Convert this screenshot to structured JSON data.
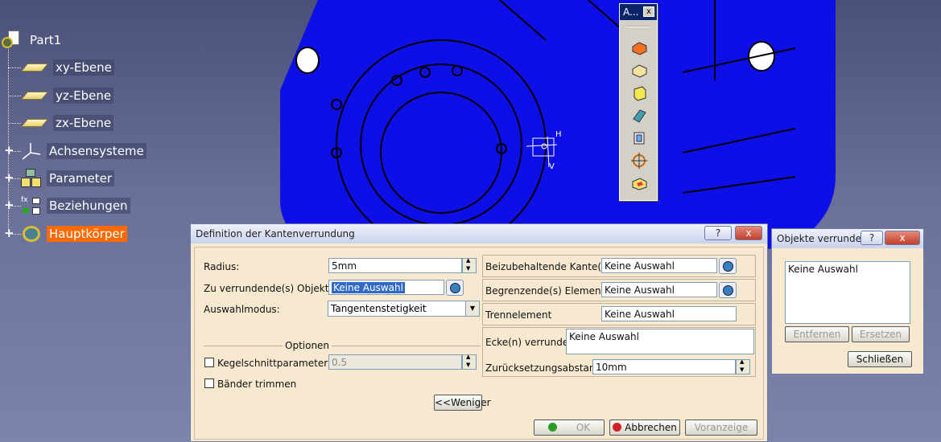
{
  "tree": {
    "root": "Part1",
    "items": [
      "xy-Ebene",
      "yz-Ebene",
      "zx-Ebene",
      "Achsensysteme",
      "Parameter",
      "Beziehungen",
      "Hauptkörper"
    ]
  },
  "toolbar": {
    "title": "A...",
    "close": "x",
    "icons": [
      "pad-icon",
      "pocket-icon",
      "solid-icon",
      "sweep-icon",
      "shaft-icon",
      "point-target-icon",
      "box-icon"
    ]
  },
  "compass_labels": {
    "h": "H",
    "v": "V"
  },
  "fillet_dialog": {
    "title": "Definition der Kantenverrundung",
    "help": "?",
    "close": "x",
    "radius_label": "Radius:",
    "radius_value": "5mm",
    "objects_label": "Zu verrundende(s) Objekt(e):",
    "objects_value": "Keine Auswahl",
    "mode_label": "Auswahlmodus:",
    "mode_value": "Tangentenstetigkeit",
    "options_label": "Optionen",
    "conic_label": "Kegelschnittparameter:",
    "conic_value": "0.5",
    "trim_label": "Bänder trimmen",
    "less_button": "<<Weniger",
    "keep_edge_label": "Beizubehaltende Kante(n):",
    "keep_edge_value": "Keine Auswahl",
    "limit_label": "Begrenzende(s) Element(e):",
    "limit_value": "Keine Auswahl",
    "separator_label": "Trennelement",
    "separator_value": "Keine Auswahl",
    "corner_label": "Ecke(n) verrunden",
    "corner_value": "Keine Auswahl",
    "setback_label": "Zurücksetzungsabstand:",
    "setback_value": "10mm",
    "ok": "OK",
    "cancel": "Abbrechen",
    "preview": "Voranzeige"
  },
  "objects_dialog": {
    "title": "Objekte verrunden",
    "help": "?",
    "close": "x",
    "list_value": "Keine Auswahl",
    "remove": "Entfernen",
    "replace": "Ersetzen",
    "close_button": "Schließen"
  },
  "colors": {
    "part": "#0e0ee6",
    "selection": "#ff6a00",
    "dialog_bg": "#f6e9cf",
    "title_active": "#0a246a"
  }
}
